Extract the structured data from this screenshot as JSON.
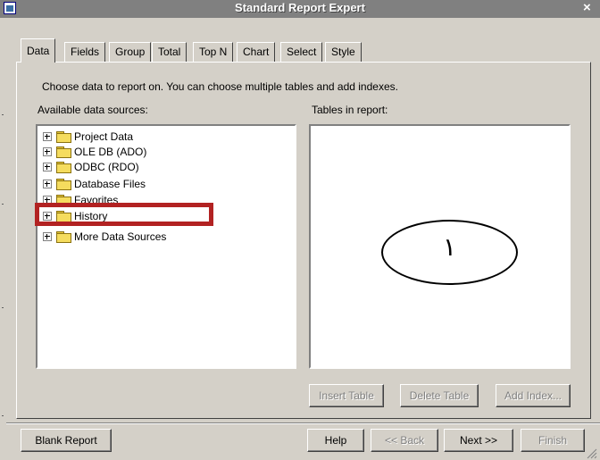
{
  "window": {
    "title": "Standard Report Expert",
    "close_glyph": "×"
  },
  "tabs": [
    {
      "label": "Data"
    },
    {
      "label": "Fields"
    },
    {
      "label": "Group"
    },
    {
      "label": "Total"
    },
    {
      "label": "Top N"
    },
    {
      "label": "Chart"
    },
    {
      "label": "Select"
    },
    {
      "label": "Style"
    }
  ],
  "active_tab": "Data",
  "instructions": "Choose data to report on. You can choose multiple tables and add indexes.",
  "available": {
    "label": "Available data sources:",
    "items": [
      {
        "label": "Project Data"
      },
      {
        "label": "OLE DB (ADO)"
      },
      {
        "label": "ODBC (RDO)"
      },
      {
        "label": "Database Files"
      },
      {
        "label": "Favorites"
      },
      {
        "label": "History"
      },
      {
        "label": "More Data Sources"
      }
    ]
  },
  "tables": {
    "label": "Tables in report:"
  },
  "buttons": {
    "insert_table": "Insert Table",
    "delete_table": "Delete Table",
    "add_index": "Add Index...",
    "blank_report": "Blank Report",
    "help": "Help",
    "back": "<< Back",
    "next": "Next >>",
    "finish": "Finish"
  },
  "annotation": {
    "number": "١",
    "highlight_color": "#b22222"
  }
}
